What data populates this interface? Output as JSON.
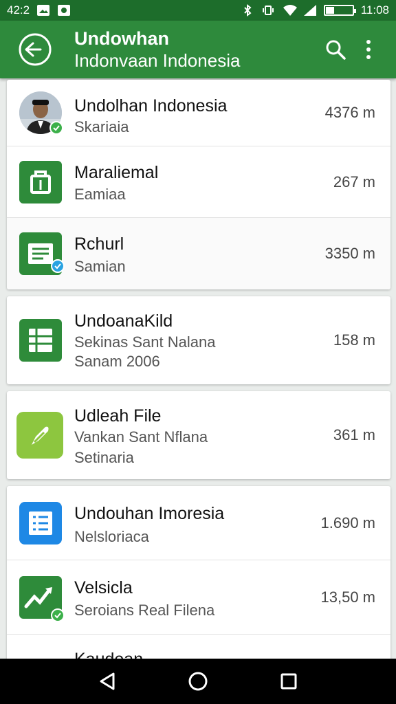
{
  "status_bar": {
    "time_left": "42:2",
    "time_right": "11:08"
  },
  "app_bar": {
    "title": "Undowhan",
    "subtitle": "Indonvaan Indonesia",
    "back_icon": "back-arrow-icon",
    "search_icon": "search-icon",
    "menu_icon": "more-vert-icon"
  },
  "items": [
    {
      "title": "Undolhan Indonesia",
      "sub1": "Skariaia",
      "size": "4376 m",
      "icon": "avatar",
      "badge": "green-check"
    },
    {
      "title": "Maraliemal",
      "sub1": "Eamiaa",
      "size": "267 m",
      "icon": "bag-icon",
      "color": "#2e8b3a"
    },
    {
      "title": "Rchurl",
      "sub1": "Samian",
      "size": "3350 m",
      "icon": "doc-icon",
      "color": "#2e8b3a",
      "badge": "blue-check"
    },
    {
      "title": "UndoanaKild",
      "sub1": "Sekinas Sant Nalana",
      "sub2": "Sanam 2006",
      "size": "158 m",
      "icon": "sheet-icon",
      "color": "#2e8b3a"
    },
    {
      "title": "Udleah File",
      "sub1": "Vankan Sant Nflana",
      "sub2": "Setinaria",
      "size": "361 m",
      "icon": "pen-icon",
      "color": "#8dc63f"
    },
    {
      "title": "Undouhan Imoresia",
      "sub1": "Nelsloriaca",
      "size": "1.690 m",
      "icon": "list-icon",
      "color": "#1e88e5"
    },
    {
      "title": "Velsicla",
      "sub1": "Seroians Real Filena",
      "size": "13,50 m",
      "icon": "chart-icon",
      "color": "#2e8b3a",
      "badge": "green-check"
    },
    {
      "title": "Kaudean"
    }
  ],
  "nav": {
    "back": "nav-back-icon",
    "home": "nav-home-icon",
    "recents": "nav-recents-icon"
  }
}
